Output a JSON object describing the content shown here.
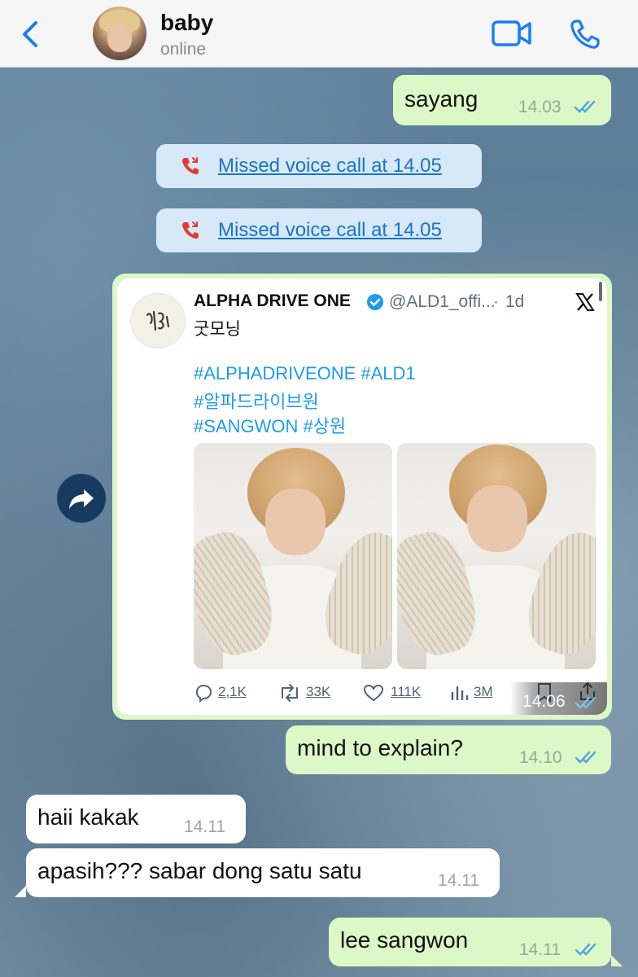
{
  "header": {
    "contact_name": "baby",
    "status": "online"
  },
  "messages": {
    "m1": {
      "text": "sayang",
      "time": "14.03"
    },
    "call1": {
      "text": "Missed voice call at 14.05"
    },
    "call2": {
      "text": "Missed voice call at 14.05"
    },
    "tweet": {
      "author": "ALPHA DRIVE ONE",
      "handle": "@ALD1_offi...",
      "separator": "·",
      "age": "1d",
      "text": "굿모닝",
      "hashtags": [
        "#ALPHADRIVEONE #ALD1",
        "#알파드라이브원",
        "#SANGWON #상원"
      ],
      "replies": "2,1K",
      "reposts": "33K",
      "likes": "111K",
      "views": "3M",
      "time": "14.06"
    },
    "m2": {
      "text": "mind to explain?",
      "time": "14.10"
    },
    "m3": {
      "text": "haii kakak",
      "time": "14.11"
    },
    "m4": {
      "text": "apasih??? sabar dong satu satu",
      "time": "14.11"
    },
    "m5": {
      "text": "lee sangwon",
      "time": "14.11"
    }
  },
  "icons": {
    "back": "chevron-left-icon",
    "video": "video-camera-icon",
    "call": "phone-icon",
    "missed_call": "missed-call-icon",
    "forward": "forward-icon",
    "read": "double-check-icon"
  },
  "colors": {
    "accent": "#1a7ff0",
    "outgoing_bubble": "#dcf8c6",
    "incoming_bubble": "#ffffff",
    "missed_call": "#e53935",
    "link": "#1d9bf0"
  }
}
